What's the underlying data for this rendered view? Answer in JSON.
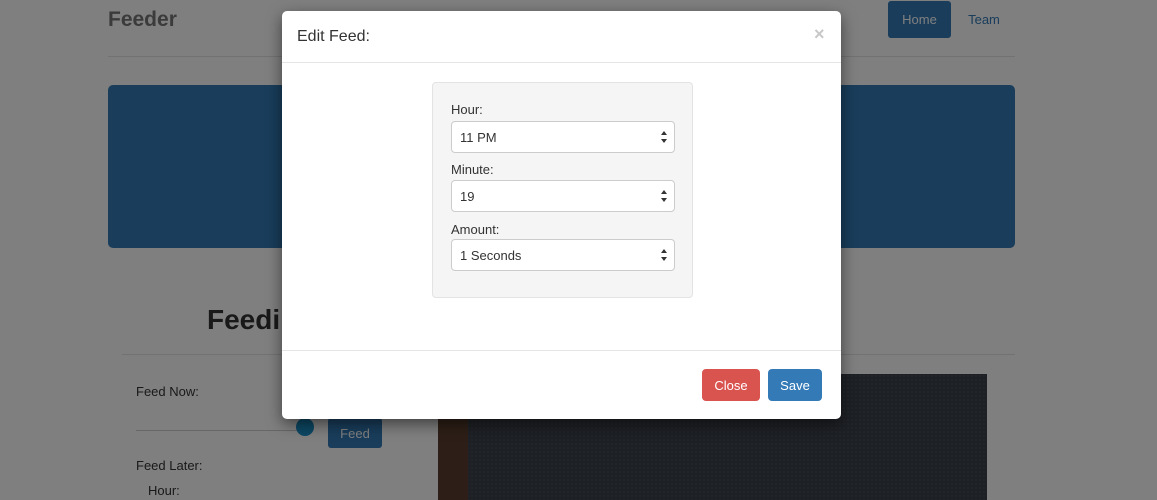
{
  "navbar": {
    "brand": "Feeder",
    "home_label": "Home",
    "team_label": "Team"
  },
  "main": {
    "section_title": "Feedi",
    "feed_now_label": "Feed Now:",
    "feed_button_label": "Feed",
    "feed_later_label": "Feed Later:",
    "hour_label": "Hour:"
  },
  "modal": {
    "title": "Edit Feed:",
    "close_icon": "×",
    "fields": {
      "hour": {
        "label": "Hour:",
        "value": "11 PM"
      },
      "minute": {
        "label": "Minute:",
        "value": "19"
      },
      "amount": {
        "label": "Amount:",
        "value": "1 Seconds"
      }
    },
    "close_label": "Close",
    "save_label": "Save"
  },
  "colors": {
    "primary": "#337ab7",
    "danger": "#d9534f",
    "slider_thumb": "#1a8ec7"
  }
}
